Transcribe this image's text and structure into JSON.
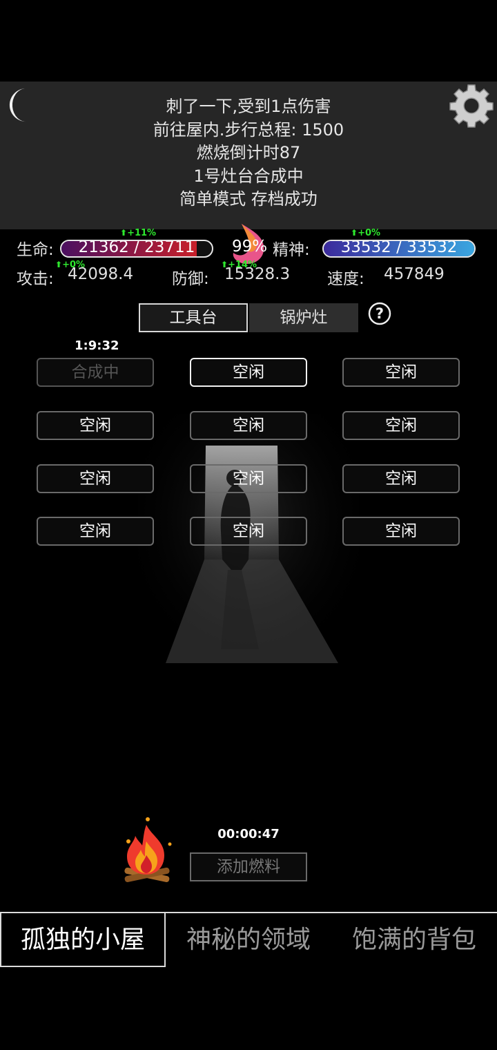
{
  "log": {
    "lines": [
      "刺了一下,受到1点伤害",
      "前往屋内.步行总程: 1500",
      "燃烧倒计时87",
      "1号灶台合成中",
      "简单模式 存档成功"
    ]
  },
  "stats": {
    "hp_label": "生命:",
    "hp_text": "21362 / 23711",
    "hp_fraction": 0.9009,
    "hp_buff": "+11%",
    "percent": "99%",
    "spirit_label": "精神:",
    "spirit_text": "33532 / 33532",
    "spirit_fraction": 1.0,
    "spirit_buff": "+0%",
    "attack_label": "攻击:",
    "attack_value": "42098.4",
    "attack_buff": "+0%",
    "defense_label": "防御:",
    "defense_value": "15328.3",
    "defense_buff": "+14%",
    "speed_label": "速度:",
    "speed_value": "457849"
  },
  "tabs": {
    "workbench": "工具台",
    "stove": "锅炉灶",
    "help": "?"
  },
  "crafting": {
    "timer": "1:9:32",
    "slots": [
      "合成中",
      "空闲",
      "空闲",
      "空闲",
      "空闲",
      "空闲",
      "空闲",
      "空闲",
      "空闲",
      "空闲",
      "空闲",
      "空闲"
    ]
  },
  "fuel": {
    "timer": "00:00:47",
    "button": "添加燃料"
  },
  "nav": {
    "cabin": "孤独的小屋",
    "domain": "神秘的领域",
    "backpack": "饱满的背包"
  },
  "colors": {
    "hp_bar": "#c8202a",
    "spirit_bar_start": "#3b2a9c",
    "spirit_bar_end": "#3aa6e0",
    "buff": "#2ee82e"
  },
  "icons": [
    "moon-icon",
    "gear-icon",
    "flame-icon",
    "help-icon",
    "campfire-icon"
  ]
}
